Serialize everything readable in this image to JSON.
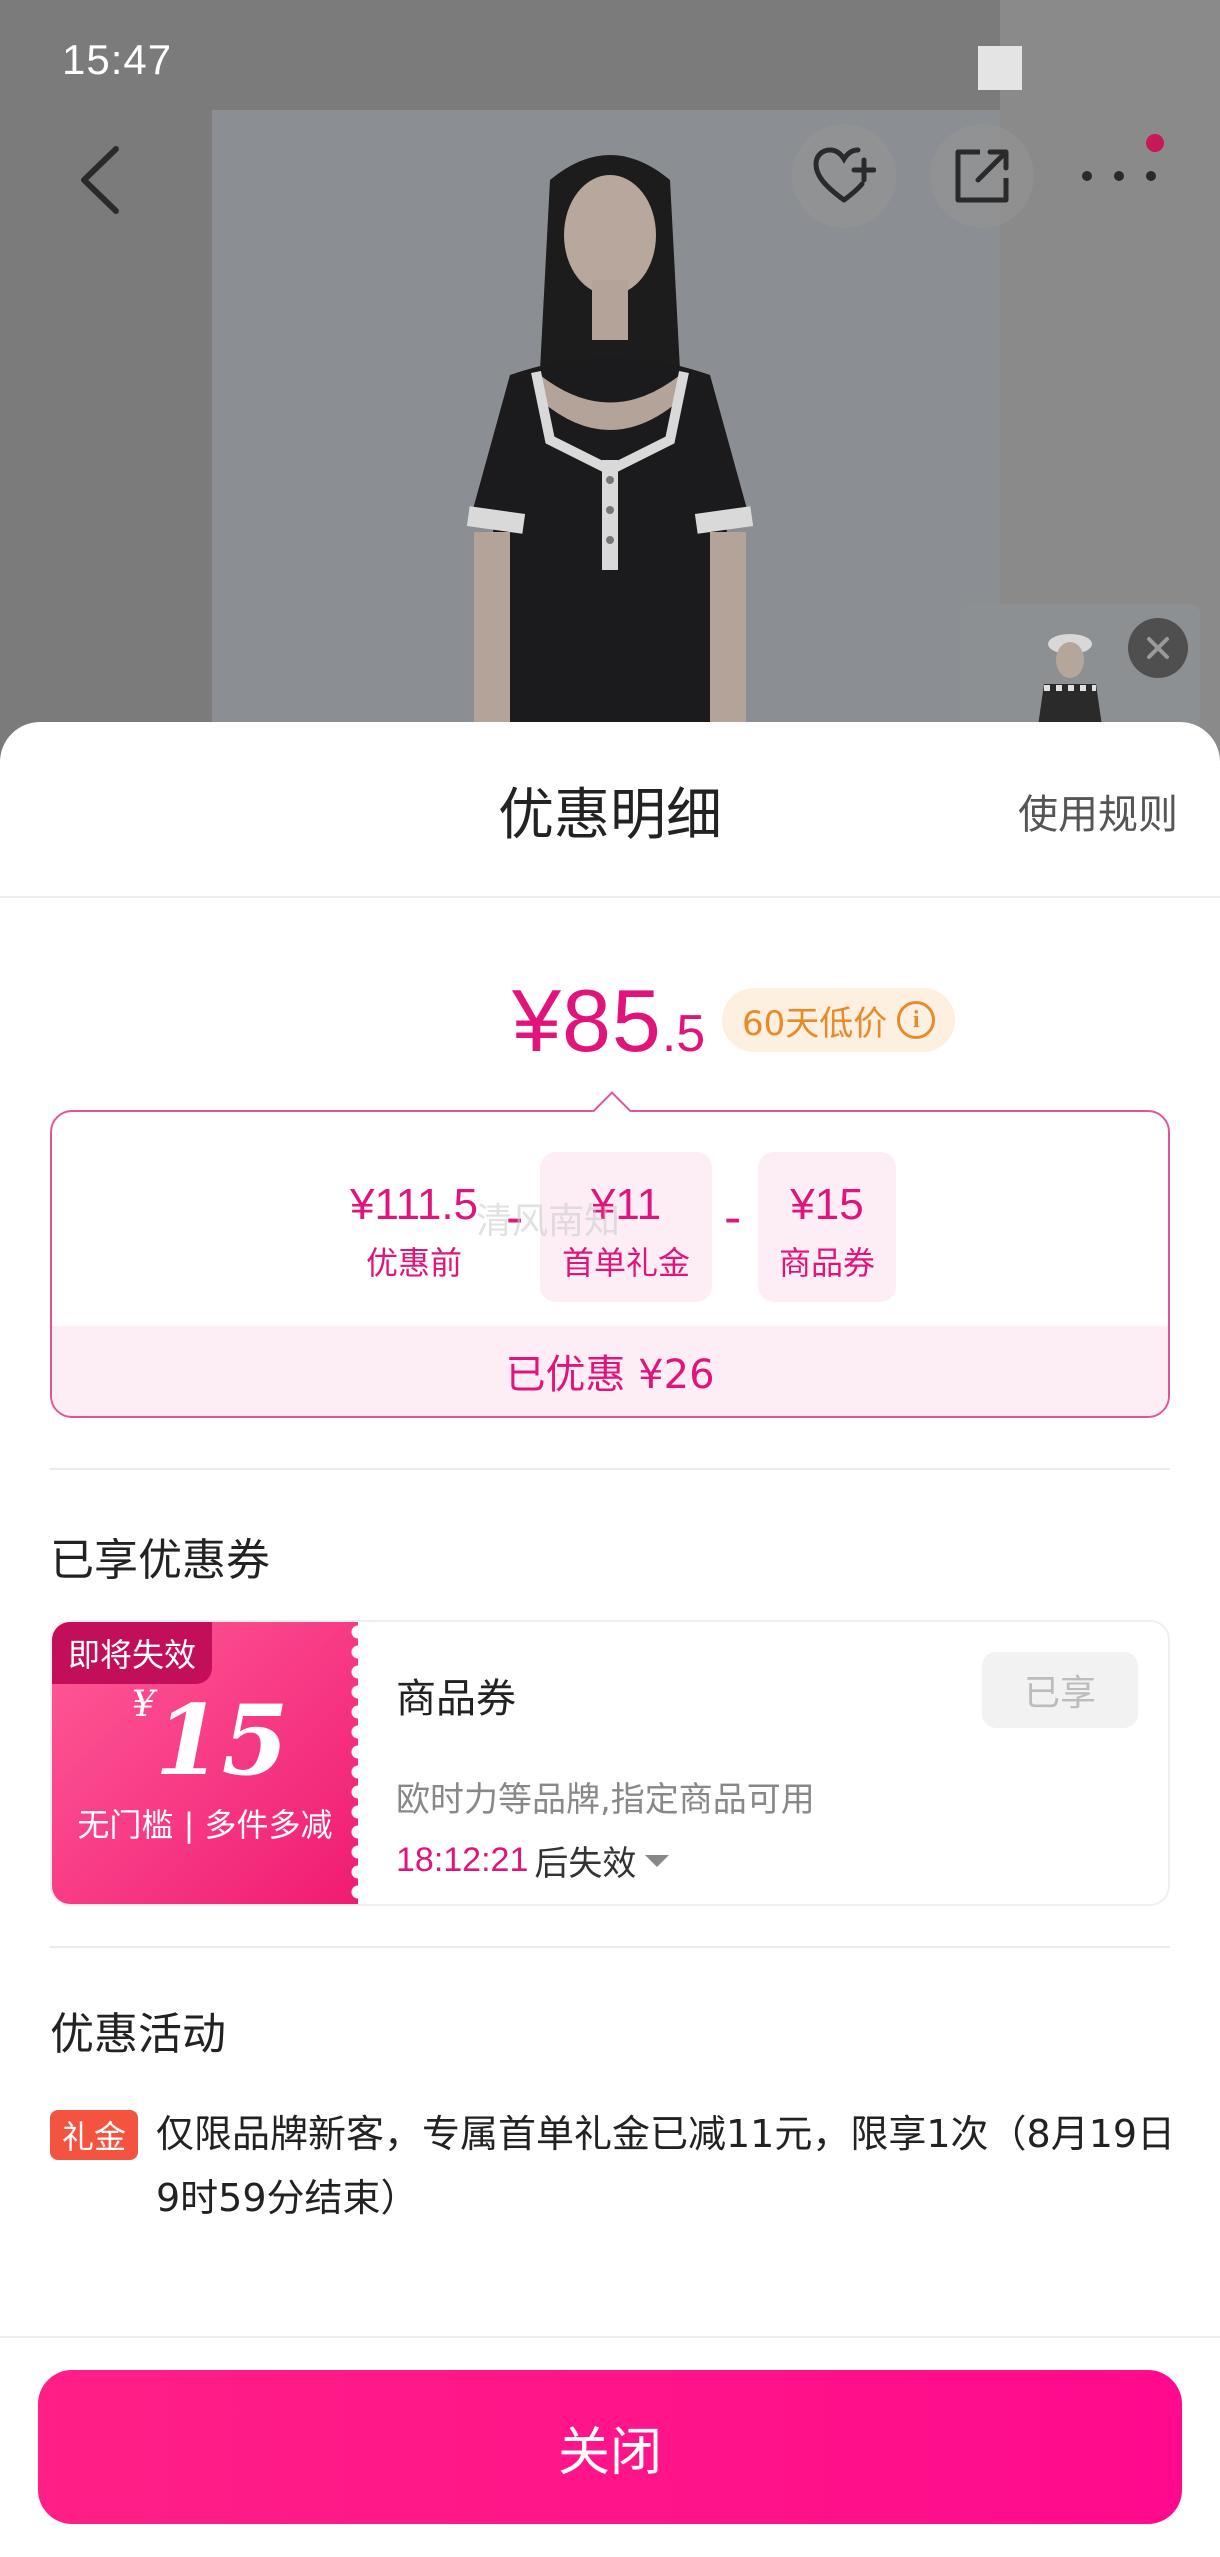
{
  "status_bar": {
    "time": "15:47"
  },
  "nav": {
    "back_icon": "chevron-left-icon",
    "favorite_icon": "heart-plus-icon",
    "share_icon": "share-icon",
    "more_icon": "more-dots-icon"
  },
  "sheet": {
    "title": "优惠明细",
    "rules_link": "使用规则",
    "final_price": {
      "main": "¥85",
      "decimal": ".5"
    },
    "low_price_badge": "60天低价",
    "breakdown": {
      "items": [
        {
          "amount": "¥111.5",
          "label": "优惠前"
        },
        {
          "amount": "¥11",
          "label": "首单礼金"
        },
        {
          "amount": "¥15",
          "label": "商品券"
        }
      ],
      "operator": "-",
      "watermark": "清风南知",
      "total": "已优惠 ¥26"
    },
    "coupons_section_title": "已享优惠券",
    "coupon": {
      "expire_tag": "即将失效",
      "currency": "¥",
      "amount": "15",
      "condition": "无门槛 | 多件多减",
      "name": "商品券",
      "status": "已享",
      "description": "欧时力等品牌,指定商品可用",
      "timer": "18:12:21",
      "timer_suffix": "后失效"
    },
    "activities_section_title": "优惠活动",
    "activity": {
      "tag": "礼金",
      "text": "仅限品牌新客，专属首单礼金已减11元，限享1次（8月19日9时59分结束）"
    },
    "close_button": "关闭"
  },
  "colors": {
    "accent": "#e0147a",
    "button": "#ff0a8c",
    "badge_text": "#e78a2a",
    "activity_tag": "#f4543f"
  }
}
